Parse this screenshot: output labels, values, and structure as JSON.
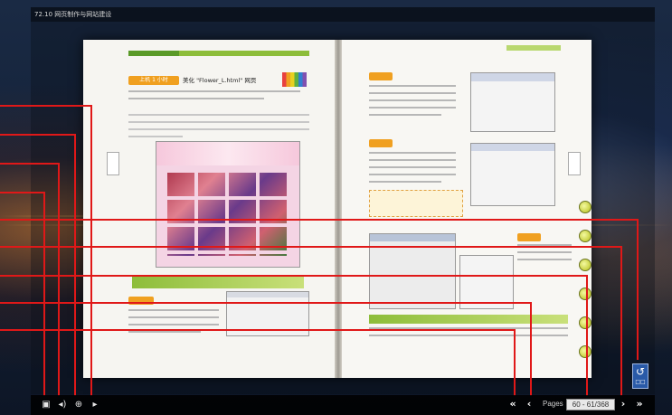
{
  "window": {
    "title": "72.10 网页制作与网站建设"
  },
  "book": {
    "left_page": {
      "section_tag": "上机 1 小时",
      "section_title": "美化 \"Flower_L.html\" 网页"
    }
  },
  "toolbar": {
    "pages_label": "Pages",
    "page_value": "60 - 61/368"
  },
  "icons": {
    "thumbnail": "▣",
    "sound": "◂)",
    "zoom": "⊕",
    "autoplay": "▸",
    "first": "«",
    "prev": "‹",
    "next": "›",
    "last": "»"
  },
  "side_button": {
    "glyph": "↺",
    "mini": "□□"
  },
  "colors": {
    "accent_green": "#8dbd3a",
    "callout_red": "#e01818",
    "tag_orange": "#f0a020"
  }
}
